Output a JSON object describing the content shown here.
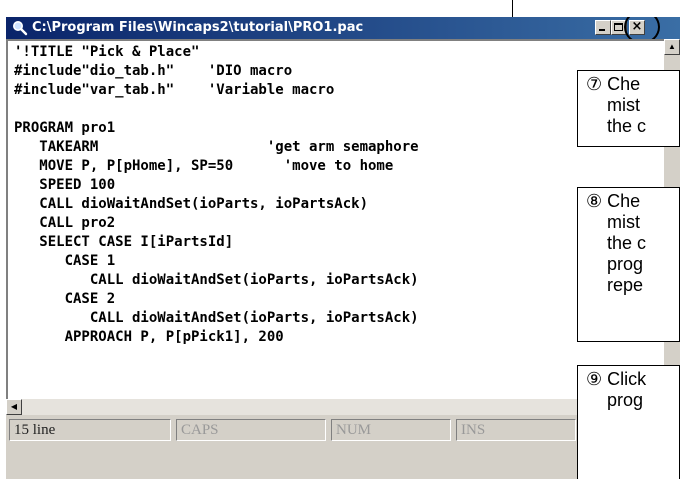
{
  "window": {
    "title": "C:\\Program Files\\Wincaps2\\tutorial\\PRO1.pac",
    "minimize_glyph": "_",
    "close_glyph": "×"
  },
  "editor": {
    "lines": [
      "'!TITLE \"Pick & Place\"",
      "#include\"dio_tab.h\"    'DIO macro",
      "#include\"var_tab.h\"    'Variable macro",
      "",
      "PROGRAM pro1",
      "   TAKEARM                    'get arm semaphore",
      "   MOVE P, P[pHome], SP=50      'move to home",
      "   SPEED 100",
      "   CALL dioWaitAndSet(ioParts, ioPartsAck)",
      "   CALL pro2",
      "   SELECT CASE I[iPartsId]",
      "      CASE 1",
      "         CALL dioWaitAndSet(ioParts, ioPartsAck)",
      "      CASE 2",
      "         CALL dioWaitAndSet(ioParts, ioPartsAck)",
      "      APPROACH P, P[pPick1], 200"
    ]
  },
  "scrollbar": {
    "up_glyph": "▲",
    "left_glyph": "◀"
  },
  "statusbar": {
    "line": "15 line",
    "caps": "CAPS",
    "num": "NUM",
    "ins": "INS"
  },
  "callouts": [
    {
      "number": "⑦",
      "lines": [
        "Che",
        "mist",
        "the c"
      ]
    },
    {
      "number": "⑧",
      "lines": [
        "Che",
        "mist",
        "the c",
        "prog",
        "repe"
      ]
    },
    {
      "number": "⑨",
      "lines": [
        "Click",
        "prog"
      ]
    }
  ]
}
